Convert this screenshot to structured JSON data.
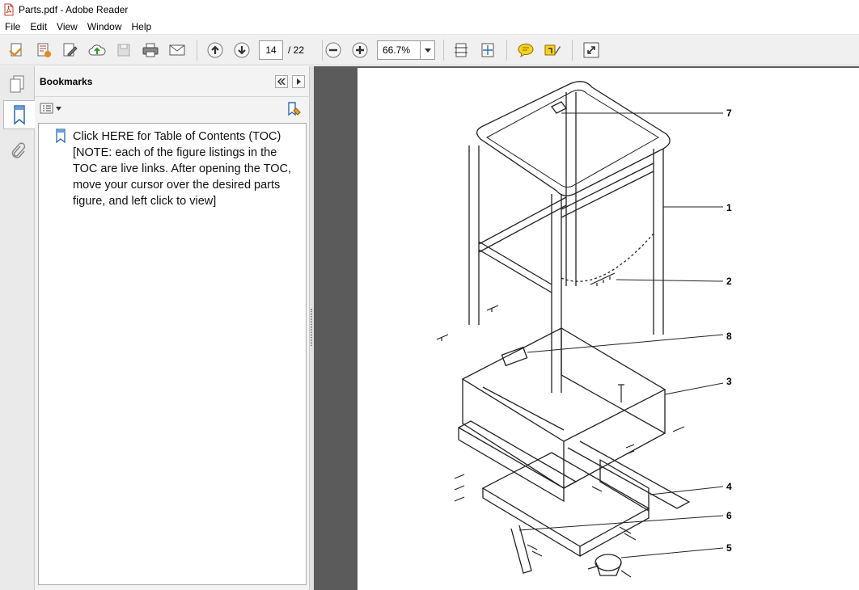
{
  "window": {
    "title": "Parts.pdf - Adobe Reader"
  },
  "menu": [
    "File",
    "Edit",
    "View",
    "Window",
    "Help"
  ],
  "toolbar": {
    "current_page": "14",
    "page_total": "/ 22",
    "zoom": "66.7%"
  },
  "bookmarks": {
    "title": "Bookmarks",
    "entries": [
      {
        "label": "Click HERE for Table of Contents (TOC) [NOTE: each of the figure listings in the TOC are live links. After opening the TOC, move your cursor over the desired parts figure, and left click to view]"
      }
    ]
  },
  "document": {
    "callouts": [
      "7",
      "1",
      "2",
      "8",
      "3",
      "4",
      "6",
      "5"
    ]
  }
}
